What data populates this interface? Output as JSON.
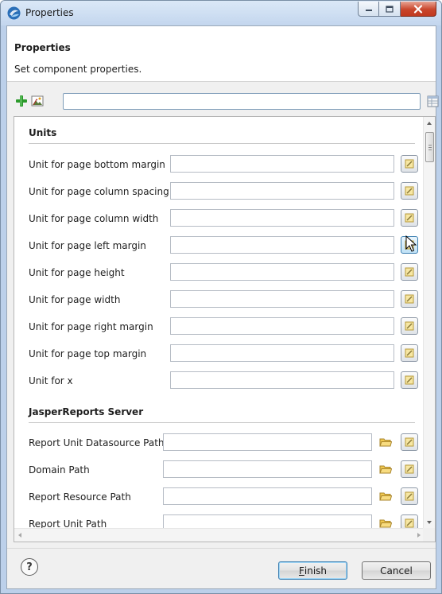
{
  "window": {
    "title": "Properties"
  },
  "header": {
    "title": "Properties",
    "description": "Set component properties."
  },
  "toolbar": {
    "add_icon": "green-plus-icon",
    "image_icon": "image-icon",
    "search_value": "",
    "table_icon": "table-view-icon"
  },
  "sections": [
    {
      "title": "Units",
      "rows": [
        {
          "label": "Unit for page bottom margin",
          "value": ""
        },
        {
          "label": "Unit for page column spacing",
          "value": ""
        },
        {
          "label": "Unit for page column width",
          "value": ""
        },
        {
          "label": "Unit for page left margin",
          "value": ""
        },
        {
          "label": "Unit for page height",
          "value": ""
        },
        {
          "label": "Unit for page width",
          "value": ""
        },
        {
          "label": "Unit for page right margin",
          "value": ""
        },
        {
          "label": "Unit for page top margin",
          "value": ""
        },
        {
          "label": "Unit for x",
          "value": ""
        }
      ]
    },
    {
      "title": "JasperReports Server",
      "rows": [
        {
          "label": "Report Unit Datasource Path",
          "value": ""
        },
        {
          "label": "Domain Path",
          "value": ""
        },
        {
          "label": "Report Resource Path",
          "value": ""
        },
        {
          "label": "Report Unit Path",
          "value": ""
        }
      ]
    }
  ],
  "footer": {
    "help_label": "?",
    "finish_mnemonic": "F",
    "finish_rest": "inish",
    "cancel_label": "Cancel"
  },
  "colors": {
    "title_bar": "#c3d6ee",
    "close_button": "#c9462c",
    "default_button_border": "#3c7fb1"
  }
}
